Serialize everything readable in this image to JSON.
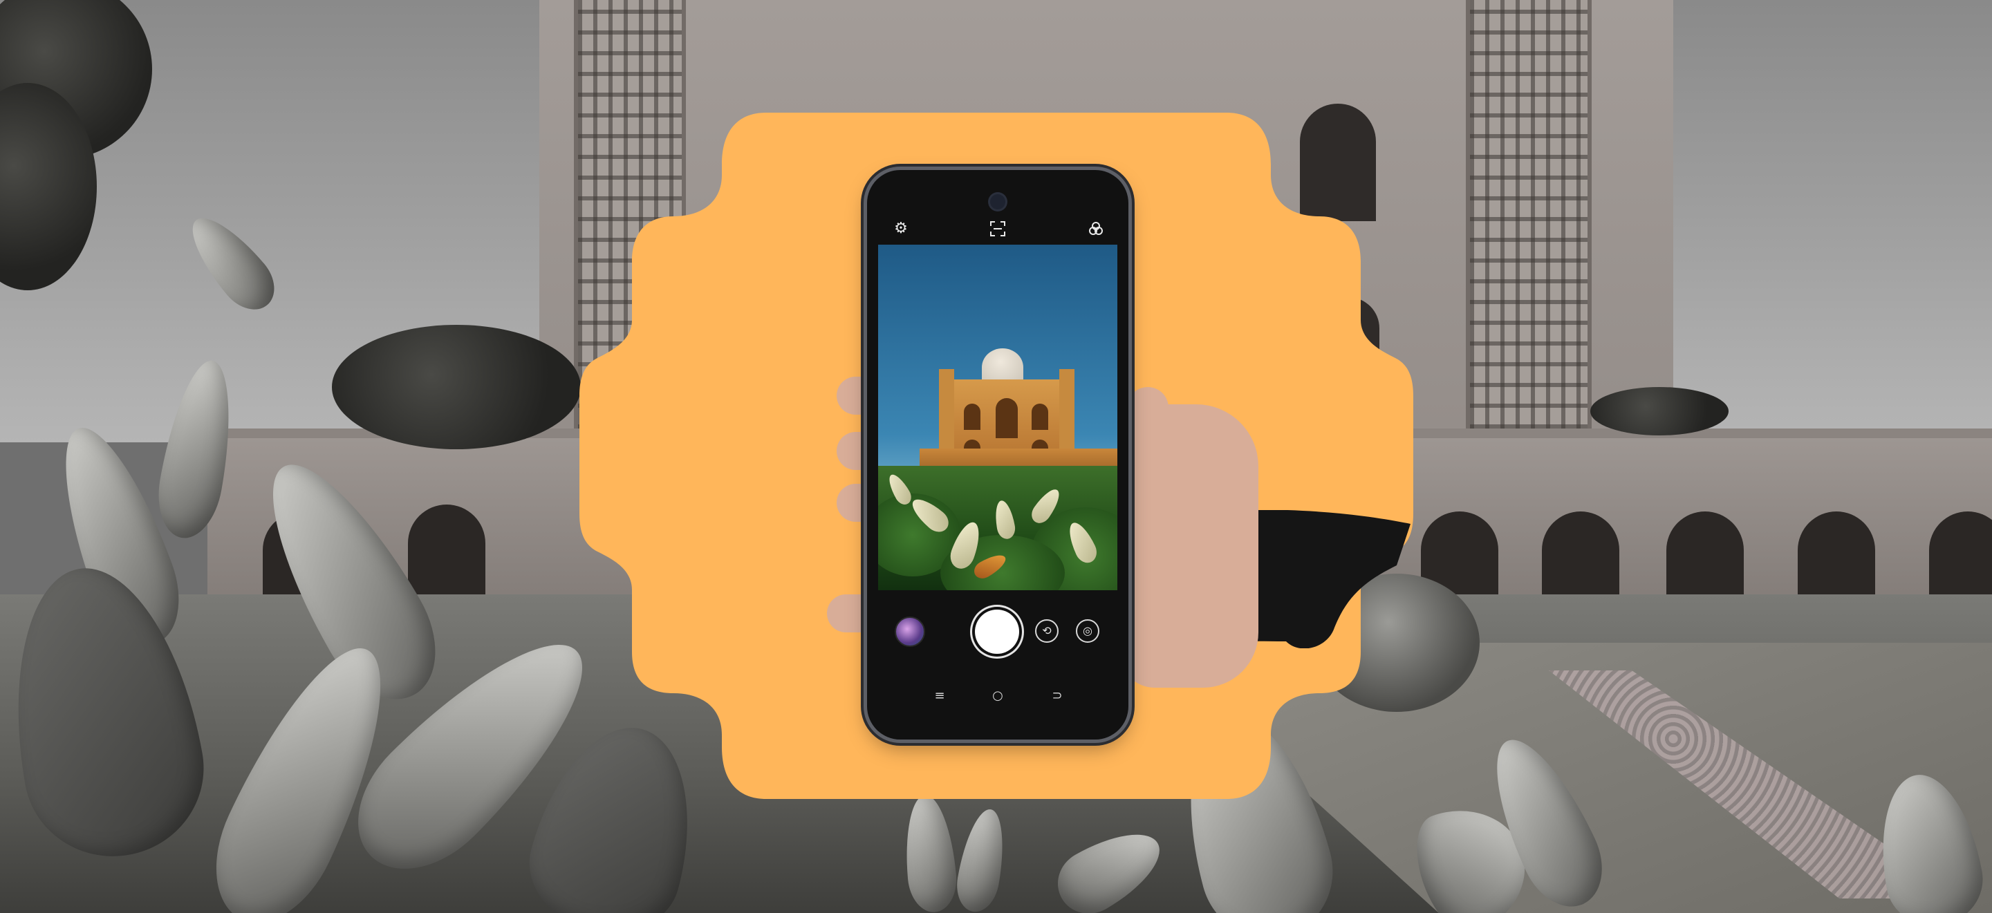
{
  "colors": {
    "accent_shape": "#FFB65A",
    "phone_body": "#111111",
    "shutter": "#FFFFFF"
  },
  "camera_app": {
    "top_icons": [
      "settings-icon",
      "scan-icon",
      "filters-icon"
    ],
    "bottom_controls": [
      "gallery-thumbnail",
      "shutter-button",
      "switch-mode-icon",
      "lens-icon"
    ],
    "nav_buttons": [
      "recent-apps-icon",
      "home-icon",
      "back-icon"
    ]
  }
}
